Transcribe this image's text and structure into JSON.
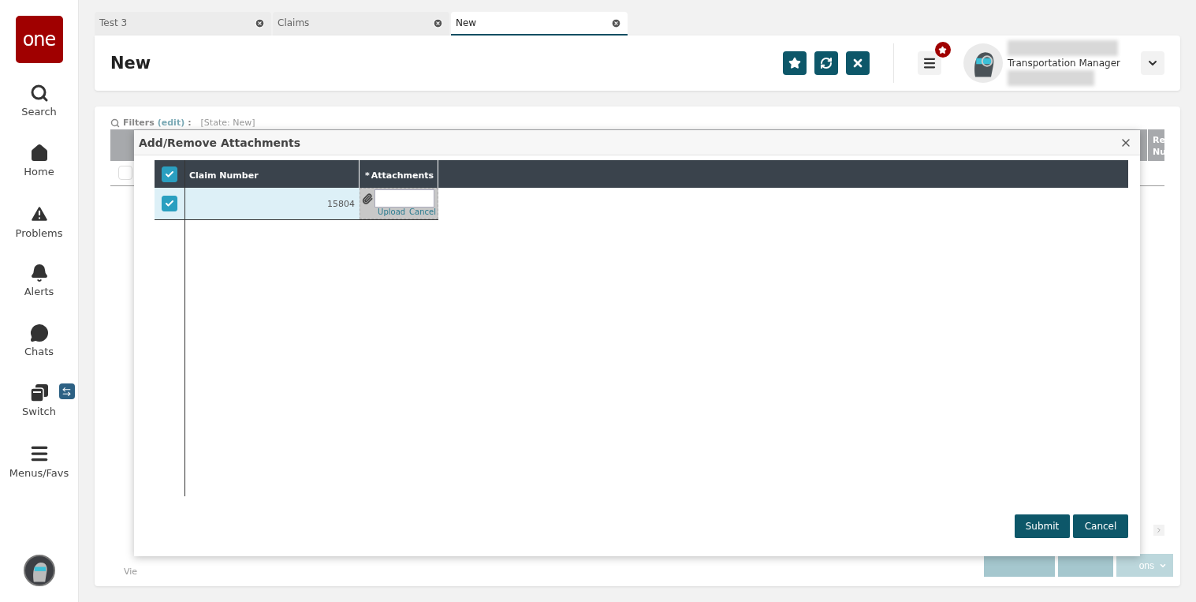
{
  "logo": "one",
  "nav": [
    {
      "kind": "search",
      "label": "Search"
    },
    {
      "kind": "home",
      "label": "Home"
    },
    {
      "kind": "problems",
      "label": "Problems"
    },
    {
      "kind": "alerts",
      "label": "Alerts"
    },
    {
      "kind": "chats",
      "label": "Chats"
    },
    {
      "kind": "switch",
      "label": "Switch"
    },
    {
      "kind": "menus",
      "label": "Menus/Favs"
    }
  ],
  "tabs": [
    {
      "label": "Test 3",
      "selected": false
    },
    {
      "label": "Claims",
      "selected": false
    },
    {
      "label": "New",
      "selected": true
    }
  ],
  "header": {
    "title": "New",
    "user_role": "Transportation Manager"
  },
  "filters": {
    "label": "Filters",
    "edit": "(edit)",
    "suffix": ":",
    "value": "[State: New]"
  },
  "background": {
    "column_header": "Re Nu",
    "row_checked": false,
    "footer_text": "Vie",
    "action_button": "ons"
  },
  "modal": {
    "title": "Add/Remove Attachments",
    "all_selected": true,
    "columns": [
      "Claim Number",
      "Attachments"
    ],
    "required_mark": "*",
    "rows": [
      {
        "selected": true,
        "claim_number": "15804",
        "upload": "Upload",
        "cancel": "Cancel"
      }
    ],
    "buttons": [
      "Submit",
      "Cancel"
    ]
  }
}
